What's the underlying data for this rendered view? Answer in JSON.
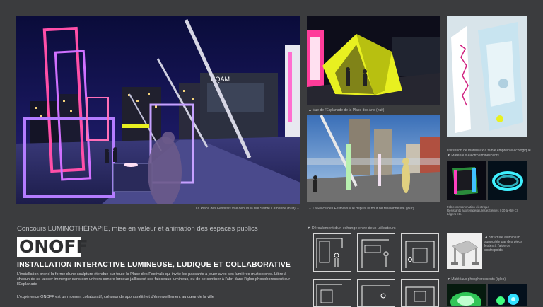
{
  "captions": {
    "main_photo": "La Place des Festivals vue depuis la rue Sainte Catherine (nuit) ▲",
    "top_right_photo": "▲ Vue de l'Esplanade de la Place des Arts (nuit)",
    "mid_right_photo": "▲ La Place des Festivals vue depuis le bout de Maisonneuve (jour)",
    "materials_intro": "Utilisation de matériaux à faible empreinte écologique",
    "materials_electro": "▼ Matériaux electroluminescents",
    "electro_note": "Fable consommation électrique\nRésistants aux températures extrêmes (-30 à +60 C)\nLégers etc.",
    "sequence_title": "▼ Déroulement d'un échange entre deux utilisateurs",
    "structure_note": "◄ Structure aluminium supportée par des pieds lestés à l'aide de contrepoids",
    "phospho_title": "▼ Matériaux phosphorescents (igloo)"
  },
  "building_sign": "UQAM",
  "contest_title": "Concours LUMINOTHÉRAPIE, mise en valeur et animation des espaces publics",
  "logo_text": "ONOFF",
  "project_title": "INSTALLATION INTERACTIVE LUMINEUSE, LUDIQUE ET COLLABORATIVE",
  "description": "L'installation prend la forme d'une sculpture étendue sur toute la Place des Festivals qui invite les passants à jouer avec ses lumières multicolores. Libre à chacun de se laisser immerger dans son univers sonore lorsque jaillissent ses faisceaux lumineux, ou de se confiner à l'abri dans l'igloo phosphorescent sur l'Esplanade",
  "tagline": "L'expérience ONOFF est un moment collaboratif, créateur de spontanéité et d'émerveillement au cœur de la ville",
  "colors": {
    "background": "#3b3c3e",
    "caption": "#b9bbbd",
    "neon_pink": "#ff4fa8",
    "neon_violet": "#b47cff",
    "neon_yellow": "#e8f020",
    "phospho_cyan": "#3ff0ff"
  }
}
